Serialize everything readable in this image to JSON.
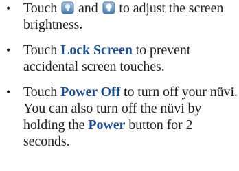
{
  "bullets": {
    "item1": {
      "text_touch": "Touch",
      "text_and": "and",
      "text_rest": "to adjust the screen brightness.",
      "icons": [
        "brightness-down-icon",
        "brightness-up-icon"
      ]
    },
    "item2": {
      "text_touch": "Touch",
      "link": "Lock Screen",
      "text_rest": "to prevent accidental screen touches."
    },
    "item3": {
      "text_touch": "Touch",
      "link": "Power Off",
      "text_mid": "to turn off your nüvi. You can also turn off the nüvi by holding the",
      "link2": "Power",
      "text_rest": "button for 2 seconds."
    }
  },
  "colors": {
    "text": "#231f20",
    "bold_text": "#1f4f8c",
    "icon_bg": "#6f9bc3"
  }
}
